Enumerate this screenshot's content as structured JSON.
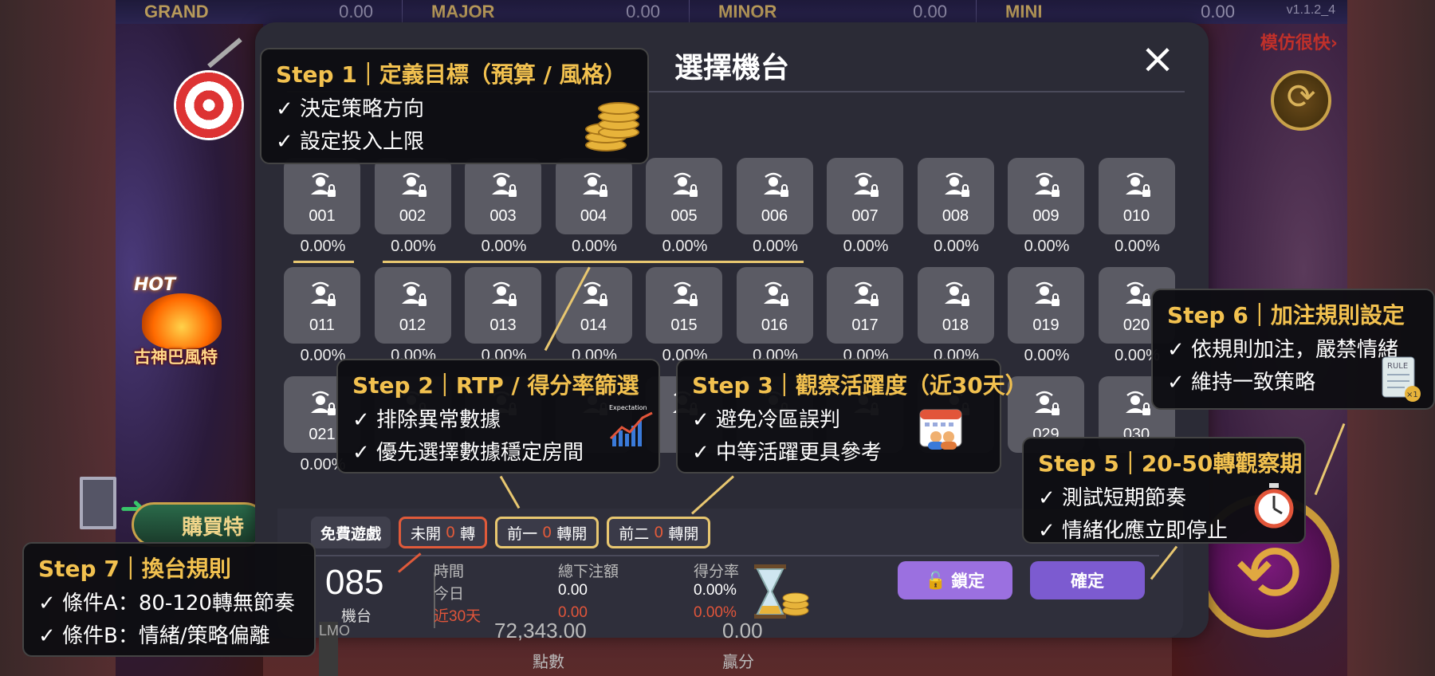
{
  "jackpots": [
    {
      "name": "GRAND",
      "value": "0.00"
    },
    {
      "name": "MAJOR",
      "value": "0.00"
    },
    {
      "name": "MINOR",
      "value": "0.00"
    },
    {
      "name": "MINI",
      "value": "0.00"
    }
  ],
  "version": "v1.1.2_4",
  "mimic_text": "模仿很快›",
  "hot_game_name": "古神巴風特",
  "hot_label": "HOT",
  "buy_button": "購買特",
  "modal": {
    "title": "選擇機台",
    "close_icon": "×"
  },
  "machines": [
    {
      "id": "001",
      "rate": "0.00%"
    },
    {
      "id": "002",
      "rate": "0.00%"
    },
    {
      "id": "003",
      "rate": "0.00%"
    },
    {
      "id": "004",
      "rate": "0.00%"
    },
    {
      "id": "005",
      "rate": "0.00%"
    },
    {
      "id": "006",
      "rate": "0.00%"
    },
    {
      "id": "007",
      "rate": "0.00%"
    },
    {
      "id": "008",
      "rate": "0.00%"
    },
    {
      "id": "009",
      "rate": "0.00%"
    },
    {
      "id": "010",
      "rate": "0.00%"
    },
    {
      "id": "011",
      "rate": "0.00%"
    },
    {
      "id": "012",
      "rate": "0.00%"
    },
    {
      "id": "013",
      "rate": "0.00%"
    },
    {
      "id": "014",
      "rate": "0.00%"
    },
    {
      "id": "015",
      "rate": "0.00%"
    },
    {
      "id": "016",
      "rate": "0.00%"
    },
    {
      "id": "017",
      "rate": "0.00%"
    },
    {
      "id": "018",
      "rate": "0.00%"
    },
    {
      "id": "019",
      "rate": "0.00%"
    },
    {
      "id": "020",
      "rate": "0.00%"
    },
    {
      "id": "021",
      "rate": "0.00%"
    },
    {
      "id": "",
      "rate": ""
    },
    {
      "id": "",
      "rate": ""
    },
    {
      "id": "",
      "rate": ""
    },
    {
      "id": "",
      "rate": ""
    },
    {
      "id": "",
      "rate": ""
    },
    {
      "id": "",
      "rate": ""
    },
    {
      "id": "",
      "rate": ""
    },
    {
      "id": "029",
      "rate": ""
    },
    {
      "id": "030",
      "rate": ""
    }
  ],
  "bottom": {
    "tab_free": "免費遊戲",
    "tab_unopened_pre": "未開",
    "tab_unopened_num": "0",
    "tab_unopened_post": "轉",
    "tab_prev1_pre": "前一",
    "tab_prev1_num": "0",
    "tab_prev1_post": "轉開",
    "tab_prev2_pre": "前二",
    "tab_prev2_num": "0",
    "tab_prev2_post": "轉開",
    "machine_number": "085",
    "machine_label": "機台",
    "col_time": "時間",
    "col_total_bet": "總下注額",
    "col_rate": "得分率",
    "row_today": "今日",
    "row_30days": "近30天",
    "today_bet": "0.00",
    "today_rate": "0.00%",
    "days30_bet": "0.00",
    "days30_rate": "0.00%",
    "lock_button": "鎖定",
    "confirm_button": "確定"
  },
  "under_panel": {
    "score_text": "72,343.00",
    "win_text": "0.00",
    "points_label": "點數",
    "win_label": "贏分",
    "side_text": "LMO"
  },
  "callouts": {
    "step1": {
      "title": "Step 1｜定義目標（預算 / 風格）",
      "items": [
        "✓ 決定策略方向",
        "✓ 設定投入上限"
      ]
    },
    "step2": {
      "title": "Step 2｜RTP / 得分率篩選",
      "items": [
        "✓ 排除異常數據",
        "✓ 優先選擇數據穩定房間"
      ],
      "icon_label": "Expectation"
    },
    "step3": {
      "title": "Step 3｜觀察活躍度（近30天）",
      "items": [
        "✓ 避免冷區誤判",
        "✓ 中等活躍更具參考"
      ]
    },
    "step5": {
      "title": "Step 5｜20-50轉觀察期",
      "items": [
        "✓ 測試短期節奏",
        "✓ 情緒化應立即停止"
      ]
    },
    "step6": {
      "title": "Step 6｜加注規則設定",
      "items": [
        "✓ 依規則加注，嚴禁情緒",
        "✓ 維持一致策略"
      ],
      "icon_label": "RULE",
      "icon_badge": "×1"
    },
    "step7": {
      "title": "Step 7｜換台規則",
      "items": [
        "✓ 條件A：80-120轉無節奏",
        "✓ 條件B：情緒/策略偏離"
      ]
    }
  },
  "colors": {
    "accent_gold": "#f2c14f",
    "lock_purple": "#9b70e0",
    "confirm_purple": "#7c5bd0",
    "warn_red": "#e05a3a"
  }
}
